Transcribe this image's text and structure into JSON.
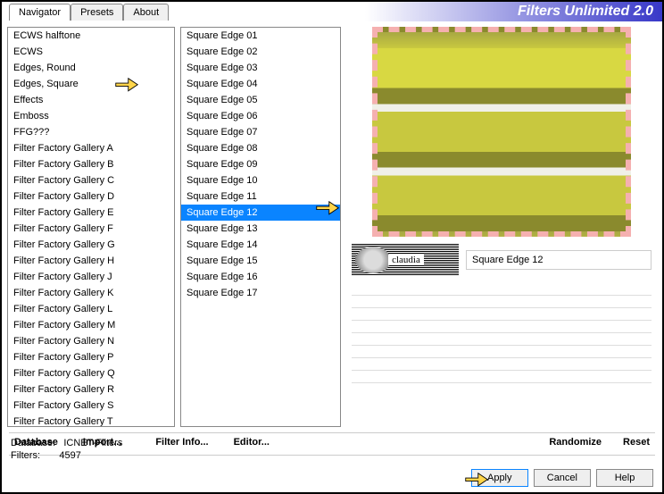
{
  "header": {
    "title": "Filters Unlimited 2.0",
    "tabs": [
      {
        "label": "Navigator",
        "active": true
      },
      {
        "label": "Presets",
        "active": false
      },
      {
        "label": "About",
        "active": false
      }
    ]
  },
  "categories": {
    "selected_index": 3,
    "items": [
      "ECWS halftone",
      "ECWS",
      "Edges, Round",
      "Edges, Square",
      "Effects",
      "Emboss",
      "FFG???",
      "Filter Factory Gallery A",
      "Filter Factory Gallery B",
      "Filter Factory Gallery C",
      "Filter Factory Gallery D",
      "Filter Factory Gallery E",
      "Filter Factory Gallery F",
      "Filter Factory Gallery G",
      "Filter Factory Gallery H",
      "Filter Factory Gallery J",
      "Filter Factory Gallery K",
      "Filter Factory Gallery L",
      "Filter Factory Gallery M",
      "Filter Factory Gallery N",
      "Filter Factory Gallery P",
      "Filter Factory Gallery Q",
      "Filter Factory Gallery R",
      "Filter Factory Gallery S",
      "Filter Factory Gallery T"
    ]
  },
  "filters": {
    "selected_index": 11,
    "items": [
      "Square Edge 01",
      "Square Edge 02",
      "Square Edge 03",
      "Square Edge 04",
      "Square Edge 05",
      "Square Edge 06",
      "Square Edge 07",
      "Square Edge 08",
      "Square Edge 09",
      "Square Edge 10",
      "Square Edge 11",
      "Square Edge 12",
      "Square Edge 13",
      "Square Edge 14",
      "Square Edge 15",
      "Square Edge 16",
      "Square Edge 17"
    ]
  },
  "preview": {
    "selected_filter_name": "Square Edge 12",
    "badge_text": "claudia"
  },
  "mid_buttons": {
    "database": "Database",
    "import": "Import...",
    "filter_info": "Filter Info...",
    "editor": "Editor...",
    "randomize": "Randomize",
    "reset": "Reset"
  },
  "status": {
    "database_label": "Database:",
    "database_value": "ICNET-Filters",
    "filters_label": "Filters:",
    "filters_value": "4597"
  },
  "buttons": {
    "apply": "Apply",
    "cancel": "Cancel",
    "help": "Help"
  }
}
